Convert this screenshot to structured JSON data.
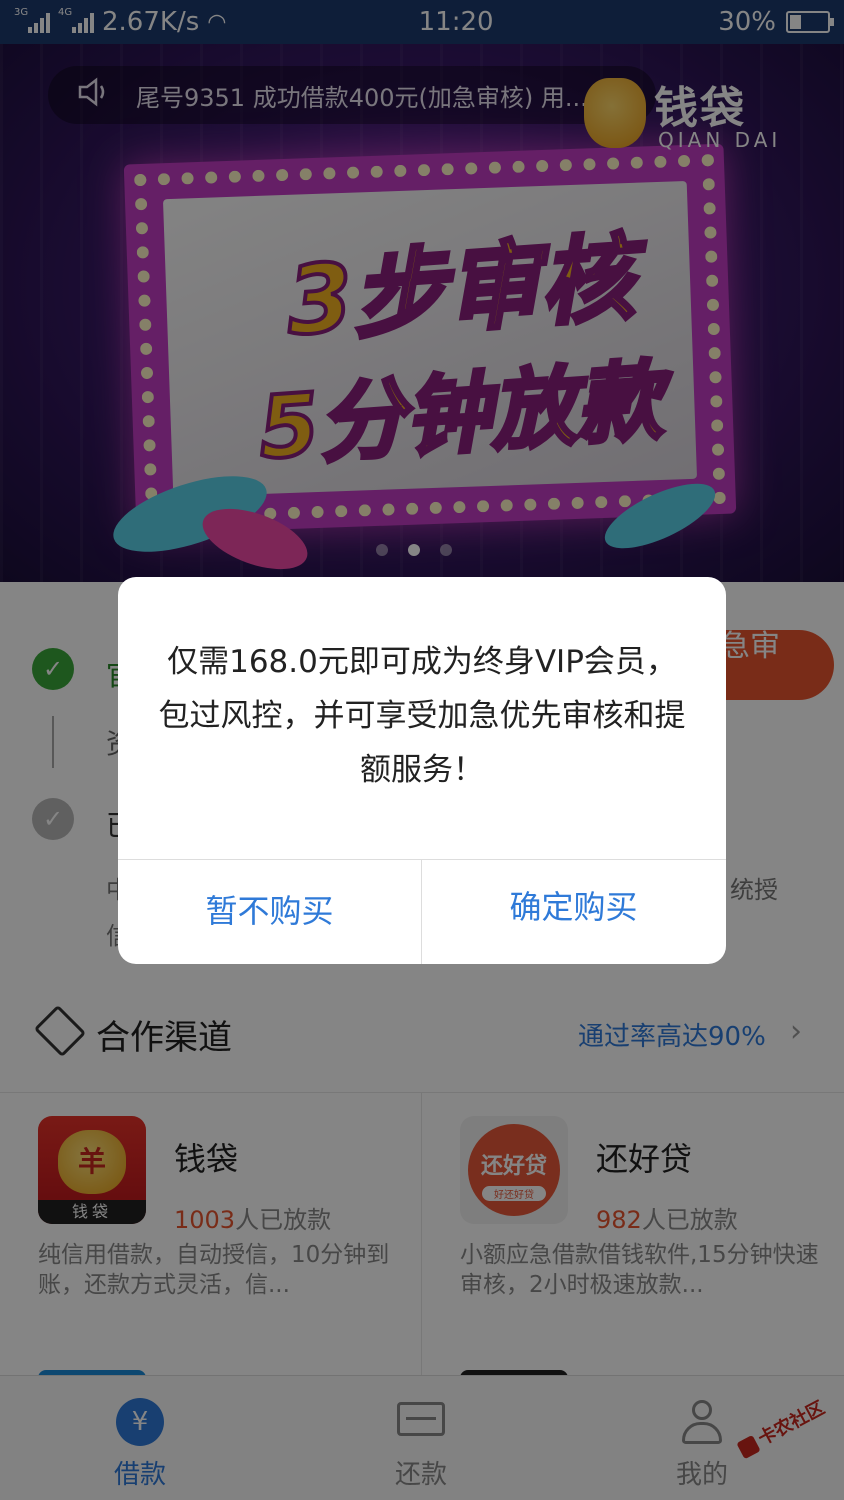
{
  "status_bar": {
    "net1": "3G",
    "net2": "4G",
    "speed": "2.67K/s",
    "time": "11:20",
    "battery": "30%",
    "battery_level": 0.3
  },
  "banner": {
    "notice": "尾号9351 成功借款400元(加急审核) 用...",
    "logo_zh": "钱袋",
    "logo_en": "QIAN DAI",
    "headline_1": "3步审核",
    "headline_2": "5分钟放款",
    "carousel_active": 2
  },
  "steps": {
    "step1_text": "官",
    "step2_text": "资",
    "step3_text": "已",
    "note_a": "中",
    "note_b": "信",
    "note_right": "统授",
    "urgent_button": "加急审核"
  },
  "section": {
    "title": "合作渠道",
    "link": "通过率高达90%"
  },
  "apps": [
    {
      "name": "钱袋",
      "count": "1003",
      "count_suffix": "人已放款",
      "desc": "纯信用借款，自动授信，10分钟到账，还款方式灵活，信...",
      "icon_text": "钱袋",
      "icon_mark": "羊"
    },
    {
      "name": "还好贷",
      "count": "982",
      "count_suffix": "人已放款",
      "desc": "小额应急借款借钱软件,15分钟快速审核，2小时极速放款...",
      "icon_text": "还好贷",
      "icon_sub": "好还好贷"
    }
  ],
  "tabbar": {
    "borrow": "借款",
    "repay": "还款",
    "mine": "我的",
    "borrow_glyph": "¥"
  },
  "watermark": "卡农社区",
  "dialog": {
    "message": "仅需168.0元即可成为终身VIP会员，包过风控，并可享受加急优先审核和提额服务！",
    "cancel": "暂不购买",
    "confirm": "确定购买"
  },
  "colors": {
    "accent_blue": "#2f7ad8",
    "accent_orange": "#e8552f",
    "status_bar": "#1c3a6e"
  }
}
